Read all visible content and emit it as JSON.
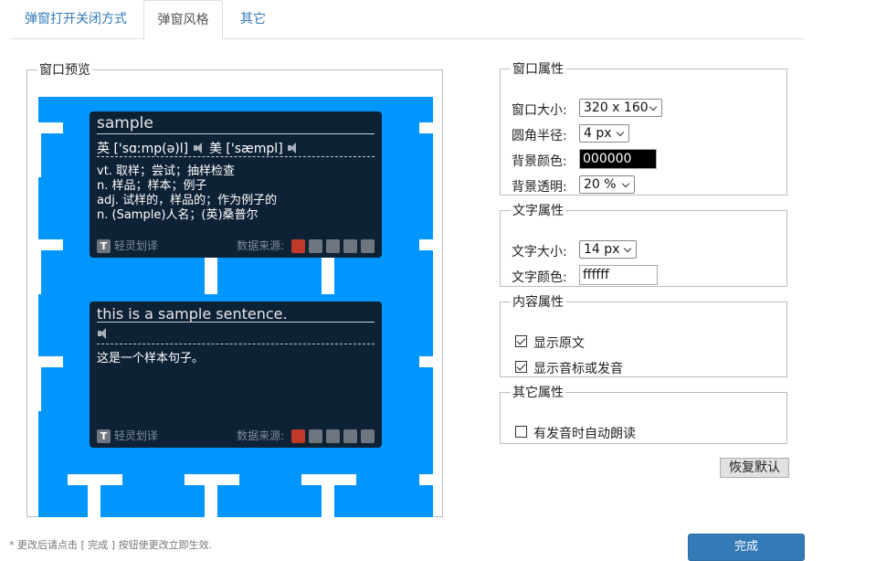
{
  "tabs": [
    {
      "label": "弹窗打开关闭方式",
      "active": false
    },
    {
      "label": "弹窗风格",
      "active": true
    },
    {
      "label": "其它",
      "active": false
    }
  ],
  "preview": {
    "legend": "窗口预览",
    "canvas_color": "#0096ff",
    "popup_bg": "#0e2236",
    "word_popup": {
      "word": "sample",
      "phonetic_uk": "英 ['sɑːmp(ə)l]",
      "phonetic_us": "美 ['sæmpl]",
      "definitions": [
        "vt. 取样；尝试；抽样检查",
        "n. 样品；样本；例子",
        "adj. 试样的，样品的；作为例子的",
        "n. (Sample)人名；(英)桑普尔"
      ],
      "footer_label": "轻灵划译",
      "source_label": "数据来源:"
    },
    "sentence_popup": {
      "sentence": "this is a sample sentence.",
      "translation": "这是一个样本句子。",
      "footer_label": "轻灵划译",
      "source_label": "数据来源:"
    }
  },
  "window_props": {
    "legend": "窗口属性",
    "size_label": "窗口大小:",
    "size_value": "320 x 160",
    "radius_label": "圆角半径:",
    "radius_value": "4 px",
    "bg_color_label": "背景颜色:",
    "bg_color_value": "000000",
    "bg_alpha_label": "背景透明:",
    "bg_alpha_value": "20 %"
  },
  "text_props": {
    "legend": "文字属性",
    "size_label": "文字大小:",
    "size_value": "14 px",
    "color_label": "文字颜色:",
    "color_value": "ffffff"
  },
  "content_props": {
    "legend": "内容属性",
    "show_original_label": "显示原文",
    "show_original_checked": true,
    "show_phonetic_label": "显示音标或发音",
    "show_phonetic_checked": true
  },
  "other_props": {
    "legend": "其它属性",
    "auto_read_label": "有发音时自动朗读",
    "auto_read_checked": false
  },
  "reset_button": "恢复默认",
  "note": "* 更改后请点击 [ 完成 ] 按钮使更改立即生效.",
  "done_button": "完成"
}
